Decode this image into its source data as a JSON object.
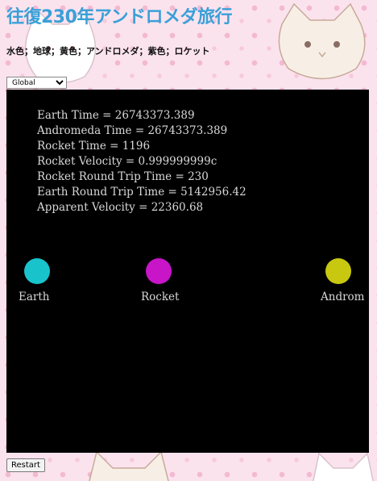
{
  "page": {
    "title": "往復230年アンドロメダ旅行",
    "legend": "水色；地球；黄色；アンドロメダ；紫色；ロケット"
  },
  "controls": {
    "frame_selected": "Global",
    "restart_label": "Restart"
  },
  "stats": {
    "earth_time": "Earth Time = 26743373.389",
    "andromeda_time": "Andromeda Time = 26743373.389",
    "rocket_time": "Rocket Time = 1196",
    "rocket_velocity": "Rocket Velocity = 0.999999999c",
    "rocket_round_trip": "Rocket Round Trip Time = 230",
    "earth_round_trip": "Earth Round Trip Time = 5142956.42",
    "apparent_velocity": "Apparent Velocity = 22360.68"
  },
  "bodies": {
    "earth": {
      "label": "Earth",
      "color": "#19c3cc"
    },
    "rocket": {
      "label": "Rocket",
      "color": "#c815c8"
    },
    "andromeda": {
      "label": "Androm",
      "color": "#c8c810"
    }
  },
  "colors": {
    "title": "#3aa0d8",
    "canvas_bg": "#000000",
    "page_bg": "#fbe3ee"
  }
}
